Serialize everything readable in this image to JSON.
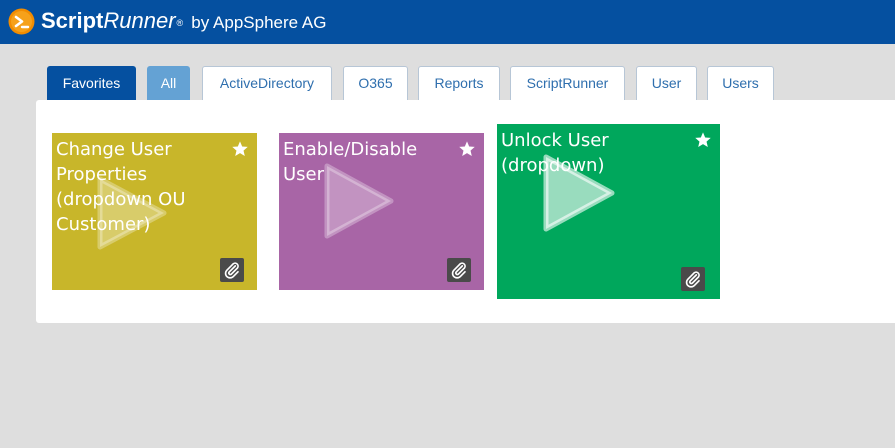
{
  "app": {
    "brand_script": "Script",
    "brand_runner": "Runner",
    "brand_reg": "®",
    "brand_by": "by AppSphere AG"
  },
  "tabs": [
    {
      "label": "Favorites",
      "state": "active"
    },
    {
      "label": "All",
      "state": "selected"
    },
    {
      "label": "ActiveDirectory",
      "state": "normal"
    },
    {
      "label": "O365",
      "state": "normal"
    },
    {
      "label": "Reports",
      "state": "normal"
    },
    {
      "label": "ScriptRunner",
      "state": "normal"
    },
    {
      "label": "User",
      "state": "normal"
    },
    {
      "label": "Users",
      "state": "normal"
    }
  ],
  "cards": [
    {
      "title": "Change User Properties (dropdown OU Customer)",
      "color": "#c8b62a",
      "favorite": true
    },
    {
      "title": "Enable/Disable User",
      "color": "#a865a6",
      "favorite": true
    },
    {
      "title": "Unlock User (dropdown)",
      "color": "#00a75c",
      "favorite": true
    }
  ],
  "colors": {
    "header": "#0550a0",
    "tab_active": "#0550a0",
    "tab_selected": "#64a2d4",
    "tab_text": "#2f6fae",
    "background": "#dedede"
  },
  "icons": {
    "logo": "scriptrunner-logo-icon",
    "favorite": "star-icon",
    "run": "play-icon",
    "attachment": "paperclip-icon"
  }
}
